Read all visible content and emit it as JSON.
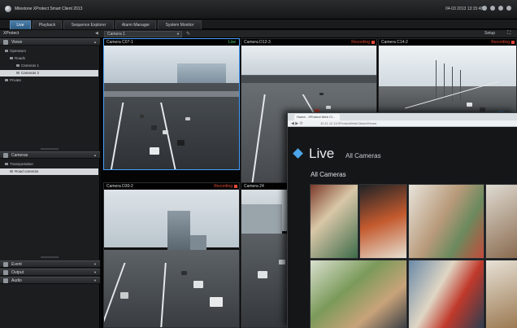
{
  "window": {
    "title": "Milestone XProtect Smart Client 2013",
    "clock": "04-03 2013 13:15:48"
  },
  "tabs": [
    {
      "label": "Live",
      "active": true
    },
    {
      "label": "Playback",
      "active": false
    },
    {
      "label": "Sequence Explorer",
      "active": false
    },
    {
      "label": "Alarm Manager",
      "active": false
    },
    {
      "label": "System Monitor",
      "active": false
    }
  ],
  "toolbar": {
    "brand": "XProtect",
    "view_select": "Camera 1",
    "setup_label": "Setup"
  },
  "sidebar": {
    "views_header": "Views",
    "tree": [
      {
        "label": "Operators",
        "selected": false
      },
      {
        "label": "Roads",
        "selected": false
      },
      {
        "label": "Cameras 1",
        "selected": false
      },
      {
        "label": "Cameras 2",
        "selected": true
      },
      {
        "label": "Private",
        "selected": false
      }
    ],
    "cameras_header": "Cameras",
    "cameras_tree": [
      {
        "label": "Transportation",
        "selected": false
      },
      {
        "label": "Road cameras",
        "selected": true
      }
    ],
    "bottom_panels": [
      "Event",
      "Output",
      "Audio"
    ]
  },
  "cameras": [
    {
      "name": "Camera C07-1",
      "status": "Live",
      "status_type": "live"
    },
    {
      "name": "Camera D12-3",
      "status": "Recording",
      "status_type": "rec"
    },
    {
      "name": "Camera C14-2",
      "status": "Recording",
      "status_type": "rec"
    },
    {
      "name": "Camera D30-2",
      "status": "Recording",
      "status_type": "rec"
    },
    {
      "name": "Camera 24",
      "status": "",
      "status_type": "none"
    }
  ],
  "browser": {
    "tab_title": "Home - XProtect Web Cl...",
    "url": "10.11.12.11/XProtectWebClient/#Home",
    "heading": "Live",
    "subheading": "All Cameras",
    "section_title": "All Cameras"
  }
}
